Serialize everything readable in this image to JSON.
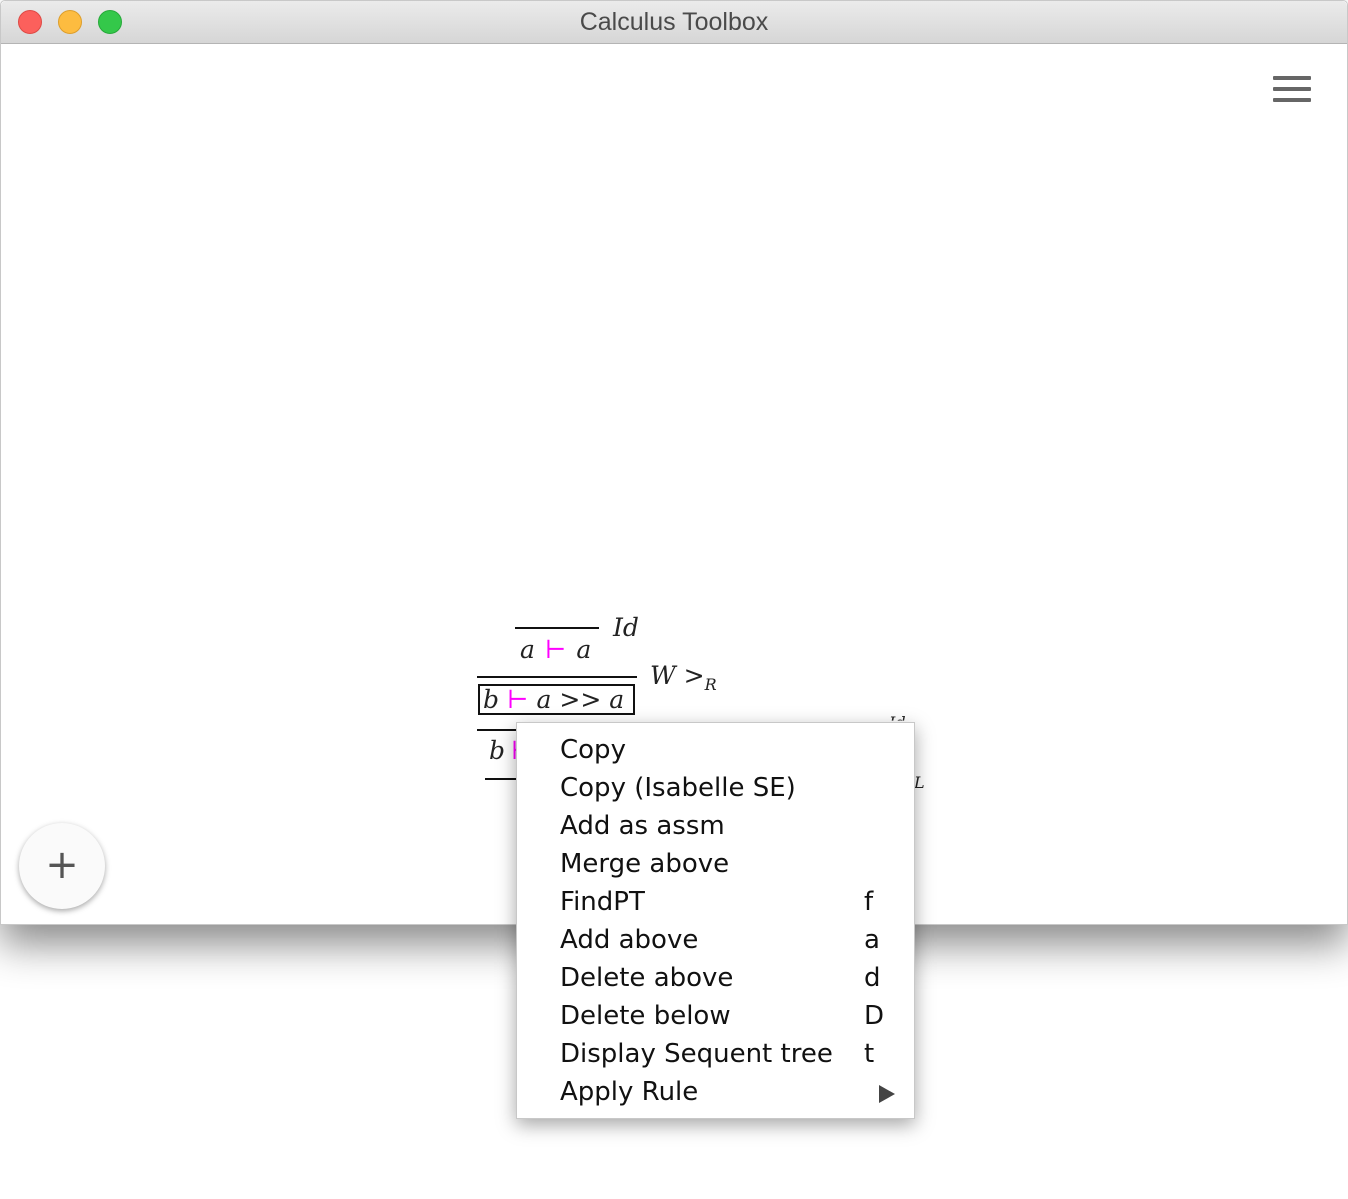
{
  "window": {
    "title": "Calculus Toolbox"
  },
  "toolbar": {
    "menu_icon": "hamburger-menu-icon"
  },
  "fab": {
    "label": "+",
    "icon": "plus-icon"
  },
  "proof_tree": {
    "top_sequent": {
      "left": "a",
      "turnstile": "⊢",
      "right": "a"
    },
    "top_rule": "Id",
    "middle_sequent": {
      "left": "b",
      "turnstile": "⊢",
      "right": "a >> a"
    },
    "middle_rule": {
      "base": "W >",
      "sub": "R"
    },
    "bottom_sequent_visible": {
      "left": "b",
      "turnstile": "⊢"
    },
    "partial_labels": [
      "Id",
      "L"
    ]
  },
  "context_menu": {
    "items": [
      {
        "label": "Copy",
        "shortcut": ""
      },
      {
        "label": "Copy (Isabelle SE)",
        "shortcut": ""
      },
      {
        "label": "Add as assm",
        "shortcut": ""
      },
      {
        "label": "Merge above",
        "shortcut": ""
      },
      {
        "label": "FindPT",
        "shortcut": "f"
      },
      {
        "label": "Add above",
        "shortcut": "a"
      },
      {
        "label": "Delete above",
        "shortcut": "d"
      },
      {
        "label": "Delete below",
        "shortcut": "D"
      },
      {
        "label": "Display Sequent tree",
        "shortcut": "t"
      },
      {
        "label": "Apply Rule",
        "shortcut": "",
        "submenu_icon": "submenu-arrow-icon"
      }
    ]
  },
  "colors": {
    "turnstile": "#ff00ff",
    "close": "#fc605c",
    "minimize": "#fdbc40",
    "maximize": "#34c84a"
  }
}
